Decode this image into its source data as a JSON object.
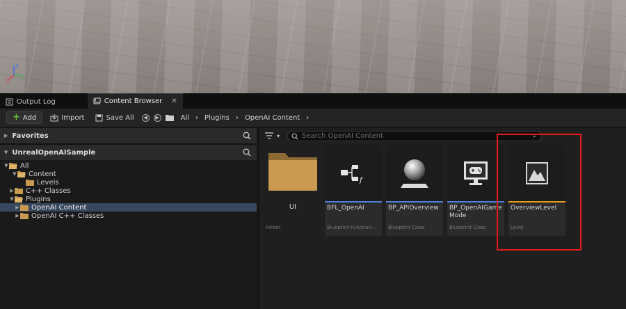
{
  "tabs": {
    "output_log": "Output Log",
    "content_browser": "Content Browser",
    "close": "✕"
  },
  "toolbar": {
    "add_label": "Add",
    "import_label": "Import",
    "save_all_label": "Save All"
  },
  "breadcrumb": [
    "All",
    "Plugins",
    "OpenAI Content"
  ],
  "left_panel": {
    "favorites_label": "Favorites",
    "project_label": "UnrealOpenAISample",
    "tree": [
      {
        "label": "All",
        "indent": 0,
        "expanded": true,
        "selected": false
      },
      {
        "label": "Content",
        "indent": 1,
        "expanded": true,
        "selected": false
      },
      {
        "label": "Levels",
        "indent": 2,
        "expanded": false,
        "selected": false,
        "leaf": true
      },
      {
        "label": "C++ Classes",
        "indent": 1,
        "expanded": false,
        "selected": false
      },
      {
        "label": "Plugins",
        "indent": 1,
        "expanded": true,
        "selected": false
      },
      {
        "label": "OpenAI Content",
        "indent": 2,
        "expanded": false,
        "selected": true
      },
      {
        "label": "OpenAI C++ Classes",
        "indent": 2,
        "expanded": false,
        "selected": false
      }
    ]
  },
  "search": {
    "placeholder": "Search OpenAI Content"
  },
  "assets": {
    "folder": {
      "name": "UI",
      "type": "Folder"
    },
    "items": [
      {
        "name": "BFL_OpenAI",
        "type": "Blueprint Function...",
        "icon": "function-library-icon",
        "bar_color": "#4f7fd6"
      },
      {
        "name": "BP_APIOverview",
        "type": "Blueprint Class",
        "icon": "sphere-icon",
        "bar_color": "#4f7fd6"
      },
      {
        "name": "BP_OpenAIGame Mode",
        "type": "Blueprint Class",
        "icon": "gamepad-monitor-icon",
        "bar_color": "#4f7fd6"
      },
      {
        "name": "OverviewLevel",
        "type": "Level",
        "icon": "level-mountain-icon",
        "bar_color": "#e59b1f"
      }
    ]
  },
  "colors": {
    "highlight": "#e01b1b",
    "selection": "#36475e",
    "folder": "#c79a50",
    "add_plus": "#6bc23a"
  }
}
